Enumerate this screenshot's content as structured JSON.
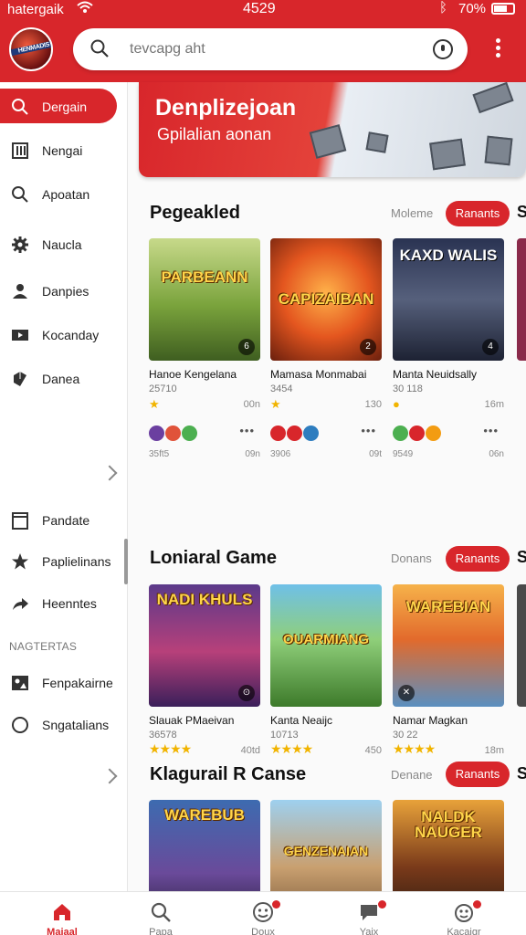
{
  "status": {
    "carrier": "hatergaik",
    "time": "4529",
    "battery": "70%"
  },
  "search": {
    "placeholder": "tevcapg aht"
  },
  "sidebar": {
    "items": [
      {
        "label": "Dergain",
        "icon": "search-icon"
      },
      {
        "label": "Nengai",
        "icon": "library-icon"
      },
      {
        "label": "Apoatan",
        "icon": "search-icon"
      },
      {
        "label": "Naucla",
        "icon": "gear-icon"
      },
      {
        "label": "Danpies",
        "icon": "person-icon"
      },
      {
        "label": "Kocanday",
        "icon": "video-icon"
      },
      {
        "label": "Danea",
        "icon": "cube-icon"
      }
    ],
    "items2": [
      {
        "label": "Pandate",
        "icon": "bookmark-icon"
      },
      {
        "label": "Paplielinans",
        "icon": "star-icon"
      },
      {
        "label": "Heenntes",
        "icon": "share-icon"
      }
    ],
    "section_label": "NAGTERTAS",
    "items3": [
      {
        "label": "Fenpakairne",
        "icon": "image-icon"
      },
      {
        "label": "Sngatalians",
        "icon": "circle-icon"
      }
    ]
  },
  "banner": {
    "title": "Denplizejoan",
    "subtitle": "Gpilalian aonan"
  },
  "sections": [
    {
      "title": "Pegeakled",
      "more": "Moleme",
      "button": "Ranants",
      "cut": "S",
      "cards": [
        {
          "thumb_title": "PARBEANN",
          "badge": "6",
          "name": "Hanoe Kengelana",
          "sub": "25710",
          "meta": "00n",
          "foot": "35ft5",
          "foot_r": "09n"
        },
        {
          "thumb_title": "CAPIZAIBAN",
          "badge": "2",
          "name": "Mamasa Monmabai",
          "sub": "3454",
          "meta": "130",
          "foot": "3906",
          "foot_r": "09t"
        },
        {
          "thumb_title": "KAXD WALIS",
          "badge": "4",
          "name": "Manta Neuidsally",
          "sub": "30 118",
          "meta": "16m",
          "foot": "9549",
          "foot_r": "06n"
        }
      ]
    },
    {
      "title": "Loniaral Game",
      "more": "Donans",
      "button": "Ranants",
      "cut": "S",
      "cards": [
        {
          "thumb_title": "NADI KHULS",
          "badge": "⊙",
          "name": "Slauak PMaeivan",
          "sub": "36578",
          "meta": "40td",
          "rating": 4
        },
        {
          "thumb_title": "OUARMIANG",
          "badge": "",
          "name": "Kanta Neaijc",
          "sub": "10713",
          "meta": "450",
          "rating": 4
        },
        {
          "thumb_title": "WAREBIAN",
          "badge": "✕",
          "name": "Namar Magkan",
          "sub": "30 22",
          "meta": "18m",
          "rating": 4
        }
      ]
    },
    {
      "title": "Klagurail R Canse",
      "more": "Denane",
      "button": "Ranants",
      "cut": "S",
      "cards": [
        {
          "thumb_title": "WAREBUB",
          "name": ""
        },
        {
          "thumb_title": "GENZENAIAN",
          "name": ""
        },
        {
          "thumb_title": "NALDK NAUGER",
          "name": ""
        }
      ]
    }
  ],
  "bottom_nav": [
    {
      "label": "Maiaal",
      "icon": "home-icon"
    },
    {
      "label": "Papa",
      "icon": "search-icon"
    },
    {
      "label": "Doux",
      "icon": "gamepad-icon"
    },
    {
      "label": "Yaix",
      "icon": "chat-icon"
    },
    {
      "label": "Kacaigr",
      "icon": "controller-icon"
    }
  ],
  "colors": {
    "accent": "#d8262b",
    "star": "#f1b400"
  }
}
